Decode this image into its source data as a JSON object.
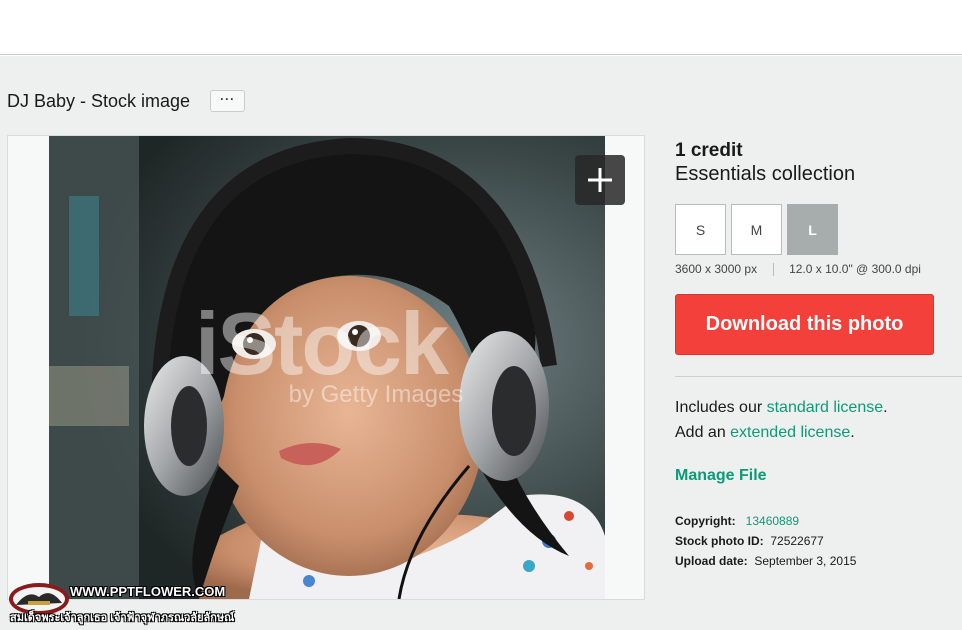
{
  "header": {
    "title": "DJ Baby - Stock image",
    "more_label": "···"
  },
  "photo": {
    "watermark_brand": "iStock",
    "watermark_byline": "by Getty Images",
    "add_label": "+"
  },
  "overlay_watermark": {
    "site": "WWW.PPTFLOWER.COM",
    "subtitle": "สมเด็จพระเจ้าลูกเธอ เจ้าฟ้าจุฬาภรณวลัยลักษณ์"
  },
  "sidebar": {
    "credit": "1 credit",
    "collection": "Essentials collection",
    "sizes": [
      {
        "label": "S"
      },
      {
        "label": "M"
      },
      {
        "label": "L"
      }
    ],
    "selected_size": "L",
    "pixel_dims": "3600 x 3000 px",
    "print_dims": "12.0 x 10.0\" @ 300.0 dpi",
    "download_label": "Download this photo",
    "license_prefix_1": "Includes our ",
    "license_link_1": "standard license",
    "license_suffix_1": ".",
    "license_prefix_2": "Add an ",
    "license_link_2": "extended license",
    "license_suffix_2": ".",
    "manage_label": "Manage File",
    "copyright_label": "Copyright:",
    "copyright_value": "13460889",
    "stock_id_label": "Stock photo ID:",
    "stock_id_value": "72522677",
    "upload_label": "Upload date:",
    "upload_value": "September 3, 2015"
  },
  "colors": {
    "accent_green": "#0c9b78",
    "download_red": "#f4403a",
    "background": "#eef0f0"
  }
}
